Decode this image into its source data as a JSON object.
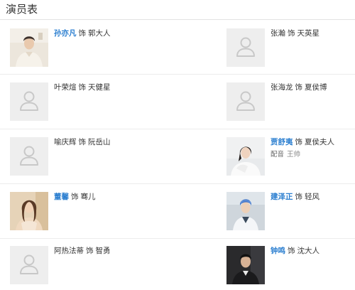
{
  "section": {
    "title": "演员表"
  },
  "cast": [
    {
      "actor": "孙亦凡",
      "as": "饰",
      "role": "郭大人",
      "linked": true,
      "photo": "portrait-young-man-light"
    },
    {
      "actor": "张瀚",
      "as": "饰",
      "role": "天英星",
      "linked": false,
      "photo": "placeholder-avatar"
    },
    {
      "actor": "叶荣煊",
      "as": "饰",
      "role": "天健星",
      "linked": false,
      "photo": "placeholder-avatar"
    },
    {
      "actor": "张海龙",
      "as": "饰",
      "role": "夏侯博",
      "linked": false,
      "photo": "placeholder-avatar"
    },
    {
      "actor": "喻庆辉",
      "as": "饰",
      "role": "阮岳山",
      "linked": false,
      "photo": "placeholder-avatar"
    },
    {
      "actor": "贾舒夷",
      "as": "饰",
      "role": "夏侯夫人",
      "linked": true,
      "photo": "portrait-woman-white",
      "voice_label": "配音",
      "voice_name": "王帅"
    },
    {
      "actor": "董馨",
      "as": "饰",
      "role": "骞儿",
      "linked": true,
      "photo": "portrait-woman-warm"
    },
    {
      "actor": "建泽正",
      "as": "饰",
      "role": "轻风",
      "linked": true,
      "photo": "portrait-man-blue"
    },
    {
      "actor": "阿热法蒂",
      "as": "饰",
      "role": "智勇",
      "linked": false,
      "photo": "placeholder-avatar"
    },
    {
      "actor": "钟鸣",
      "as": "饰",
      "role": "沈大人",
      "linked": true,
      "photo": "portrait-man-dark"
    }
  ],
  "colors": {
    "link": "#2c7fd0",
    "text": "#333333",
    "placeholder_bg": "#eeeeee",
    "placeholder_icon": "#c8c8c8"
  }
}
